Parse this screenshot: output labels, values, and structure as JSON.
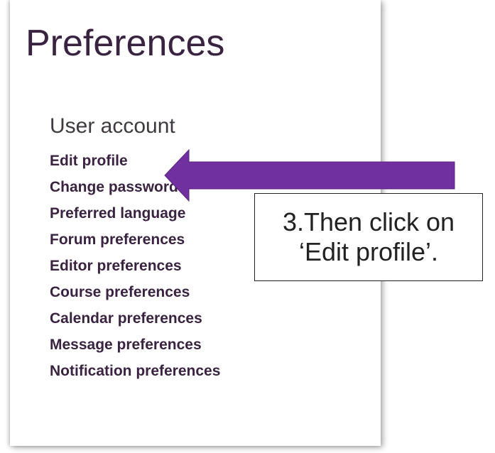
{
  "page": {
    "title": "Preferences"
  },
  "user_account": {
    "heading": "User account",
    "links": [
      {
        "label": "Edit profile"
      },
      {
        "label": "Change password"
      },
      {
        "label": "Preferred language"
      },
      {
        "label": "Forum preferences"
      },
      {
        "label": "Editor preferences"
      },
      {
        "label": "Course preferences"
      },
      {
        "label": "Calendar preferences"
      },
      {
        "label": "Message preferences"
      },
      {
        "label": "Notification preferences"
      }
    ]
  },
  "annotation": {
    "line1": "3.Then click on",
    "line2": "‘Edit profile’.",
    "arrow_color": "#7030a0"
  },
  "colors": {
    "link_text": "#3a2340",
    "heading_text": "#3e3a3f",
    "panel_bg": "#ffffff"
  }
}
